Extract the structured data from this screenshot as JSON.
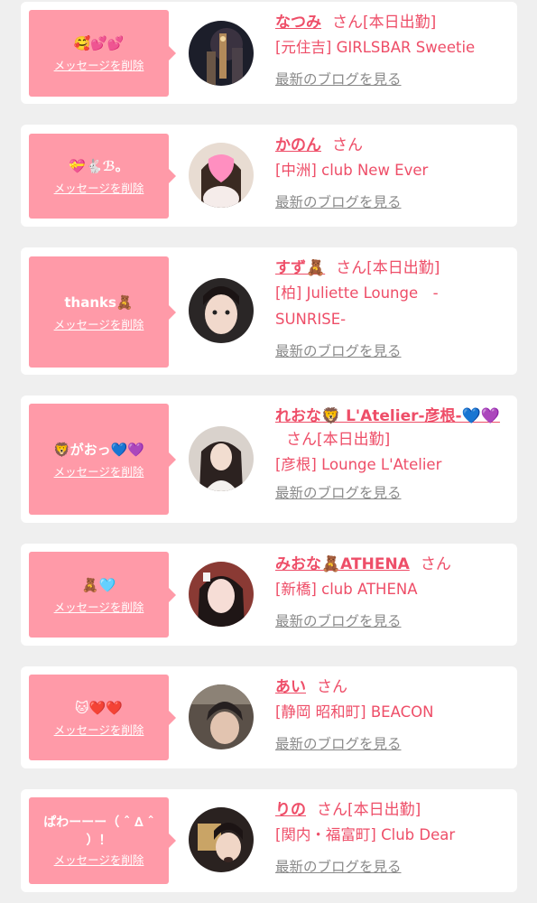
{
  "delete_label": "メッセージを削除",
  "blog_label": "最新のブログを見る",
  "colors": {
    "background": "#efefef",
    "card": "#ffffff",
    "bubble": "#ff9aa8",
    "accent": "#ee4e68",
    "muted": "#8a8a8a"
  },
  "messages": [
    {
      "message": "🥰💕💕",
      "name": "なつみ",
      "honorific": "さん",
      "status": "[本日出勤]",
      "shop": "[元住吉] GIRLSBAR Sweetie"
    },
    {
      "message": "💝🐇ℬ。",
      "name": "かのん",
      "honorific": "さん",
      "status": "",
      "shop": "[中洲] club New Ever"
    },
    {
      "message": "thanks🧸",
      "name": "すず🧸",
      "honorific": "さん",
      "status": "[本日出勤]",
      "shop": "[柏] Juliette Lounge　-SUNRISE-"
    },
    {
      "message": "🦁がおっ💙💜",
      "name": "れおな🦁 L'Atelier-彦根-💙💜",
      "honorific": "さん",
      "status": "[本日出勤]",
      "shop": "[彦根] Lounge L'Atelier"
    },
    {
      "message": "🧸🩵",
      "name": "みおな🧸ATHENA",
      "honorific": "さん",
      "status": "",
      "shop": "[新橋] club ATHENA"
    },
    {
      "message": "🐱❤️❤️",
      "name": "あい",
      "honorific": "さん",
      "status": "",
      "shop": "[静岡 昭和町] BEACON"
    },
    {
      "message": "ぱわーーー（ ˆ ∆ ˆ ）！",
      "name": "りの",
      "honorific": "さん",
      "status": "[本日出勤]",
      "shop": "[関内・福富町] Club Dear"
    }
  ]
}
